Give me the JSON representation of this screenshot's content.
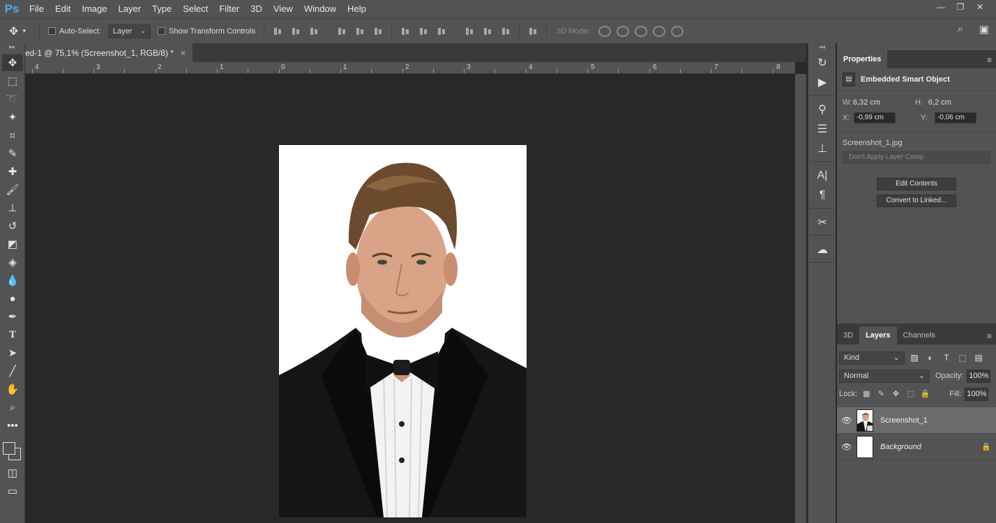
{
  "app": {
    "logo": "Ps"
  },
  "menu": [
    "File",
    "Edit",
    "Image",
    "Layer",
    "Type",
    "Select",
    "Filter",
    "3D",
    "View",
    "Window",
    "Help"
  ],
  "window_controls": {
    "minimize": "—",
    "restore": "❐",
    "close": "✕"
  },
  "options": {
    "auto_select_label": "Auto-Select:",
    "auto_select_target": "Layer",
    "show_transform_label": "Show Transform Controls",
    "mode_3d_label": "3D Mode:"
  },
  "document": {
    "tab_title": "ed-1 @ 75,1% (Screenshot_1, RGB/8) *",
    "tab_close": "×"
  },
  "ruler_h": [
    "4",
    "3",
    "2",
    "1",
    "0",
    "1",
    "2",
    "3",
    "4",
    "5",
    "6",
    "7",
    "8"
  ],
  "properties": {
    "tab": "Properties",
    "title": "Embedded Smart Object",
    "w_label": "W:",
    "w_value": "6,32 cm",
    "h_label": "H:",
    "h_value": "6,2 cm",
    "x_label": "X:",
    "x_value": "-0,99 cm",
    "y_label": "Y:",
    "y_value": "-0,06 cm",
    "file_name": "Screenshot_1.jpg",
    "layer_comp": "Don't Apply Layer Comp",
    "edit_contents": "Edit Contents",
    "convert_linked": "Convert to Linked..."
  },
  "layers_panel": {
    "tabs": [
      "3D",
      "Layers",
      "Channels"
    ],
    "active_tab": "Layers",
    "filter_kind": "Kind",
    "blend_mode": "Normal",
    "opacity_label": "Opacity:",
    "opacity_value": "100%",
    "lock_label": "Lock:",
    "fill_label": "Fill:",
    "fill_value": "100%",
    "layers": [
      {
        "name": "Screenshot_1",
        "selected": true,
        "italic": false,
        "locked": false
      },
      {
        "name": "Background",
        "selected": false,
        "italic": true,
        "locked": true
      }
    ]
  },
  "colors": {
    "chrome": "#535353",
    "canvas_bg": "#282828",
    "panel_dark": "#3a3a3a",
    "accent_ps": "#5aa7e6"
  }
}
